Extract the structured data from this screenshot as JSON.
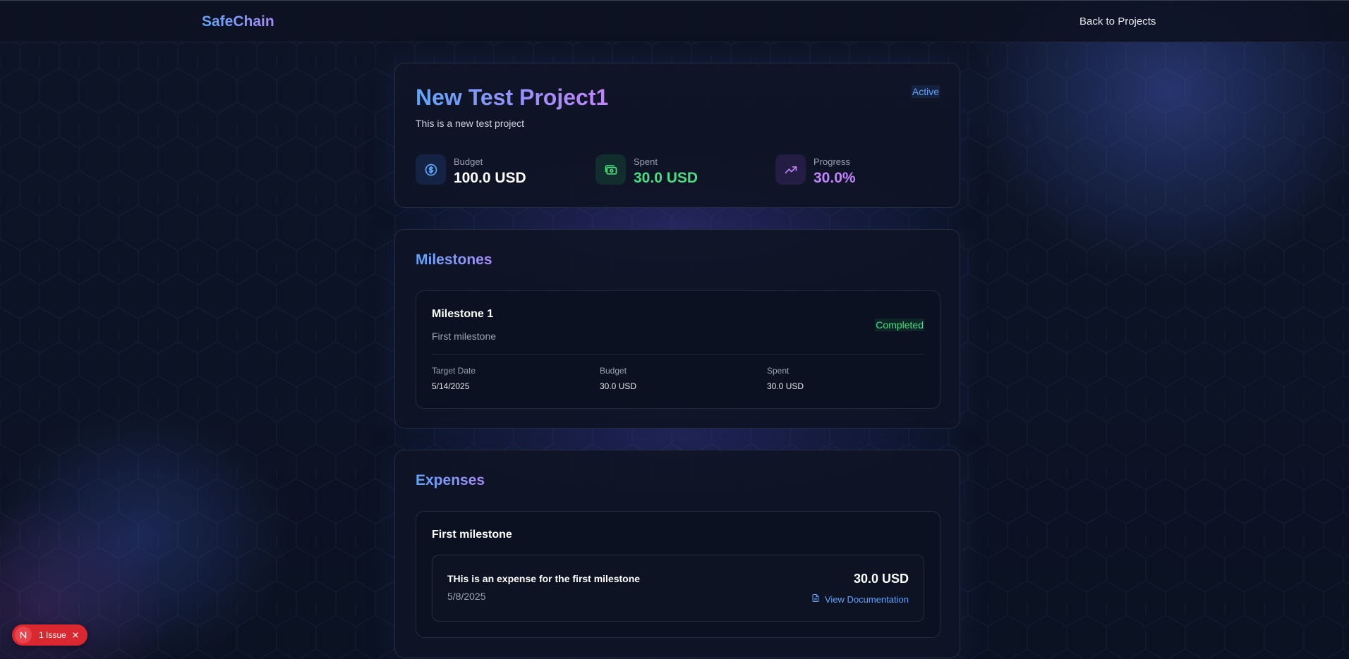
{
  "header": {
    "brand": "SafeChain",
    "back_link": "Back to Projects"
  },
  "project": {
    "title": "New Test Project1",
    "description": "This is a new test project",
    "status": "Active",
    "stats": {
      "budget": {
        "label": "Budget",
        "value": "100.0 USD",
        "icon": "dollar-circle-icon"
      },
      "spent": {
        "label": "Spent",
        "value": "30.0 USD",
        "icon": "banknote-icon"
      },
      "progress": {
        "label": "Progress",
        "value": "30.0%",
        "icon": "trending-up-icon"
      }
    }
  },
  "milestones": {
    "title": "Milestones",
    "items": [
      {
        "name": "Milestone 1",
        "description": "First milestone",
        "status": "Completed",
        "target_date_label": "Target Date",
        "target_date": "5/14/2025",
        "budget_label": "Budget",
        "budget": "30.0 USD",
        "spent_label": "Spent",
        "spent": "30.0 USD"
      }
    ]
  },
  "expenses": {
    "title": "Expenses",
    "groups": [
      {
        "title": "First milestone",
        "items": [
          {
            "description": "THis is an expense for the first milestone",
            "date": "5/8/2025",
            "amount": "30.0 USD",
            "doc_link": "View Documentation"
          }
        ]
      }
    ]
  },
  "dev_overlay": {
    "badge_letter": "N",
    "issues_label": "1 Issue"
  },
  "colors": {
    "accent_blue": "#60a5fa",
    "accent_purple": "#a78bfa",
    "success_green": "#4ade80",
    "issue_red": "#d9282f"
  }
}
